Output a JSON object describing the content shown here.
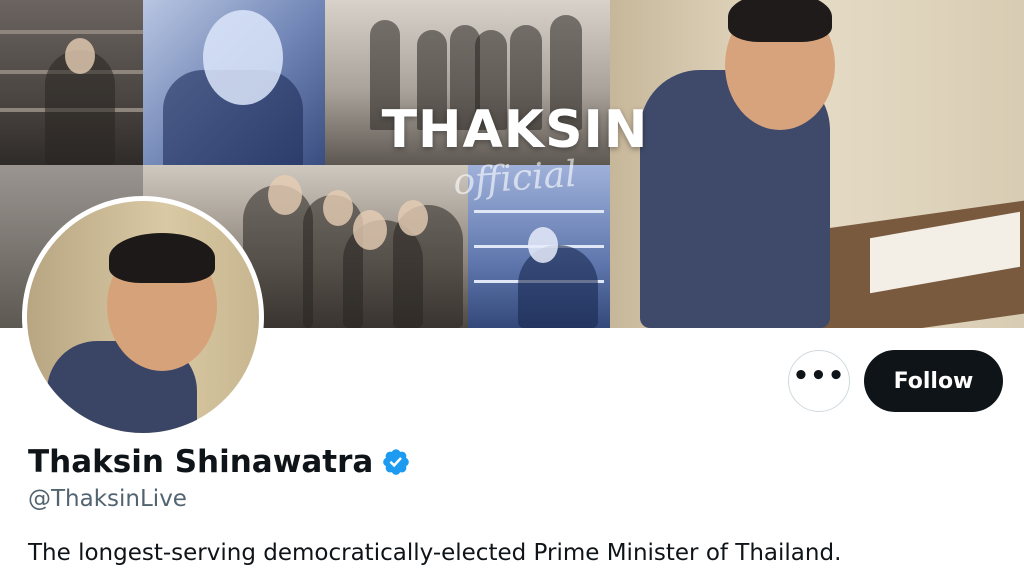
{
  "banner": {
    "title": "THAKSIN",
    "subtitle": "official"
  },
  "actions": {
    "more_label": "•••",
    "follow_label": "Follow"
  },
  "profile": {
    "display_name": "Thaksin Shinawatra",
    "handle": "@ThaksinLive",
    "verified": true,
    "bio": "The longest-serving democratically-elected Prime Minister of Thailand."
  },
  "colors": {
    "follow_button": "#0f1419",
    "verified_badge": "#1d9bf0",
    "handle_text": "#536471"
  },
  "icons": {
    "verified": "verified-badge-icon",
    "more": "more-options-icon"
  }
}
